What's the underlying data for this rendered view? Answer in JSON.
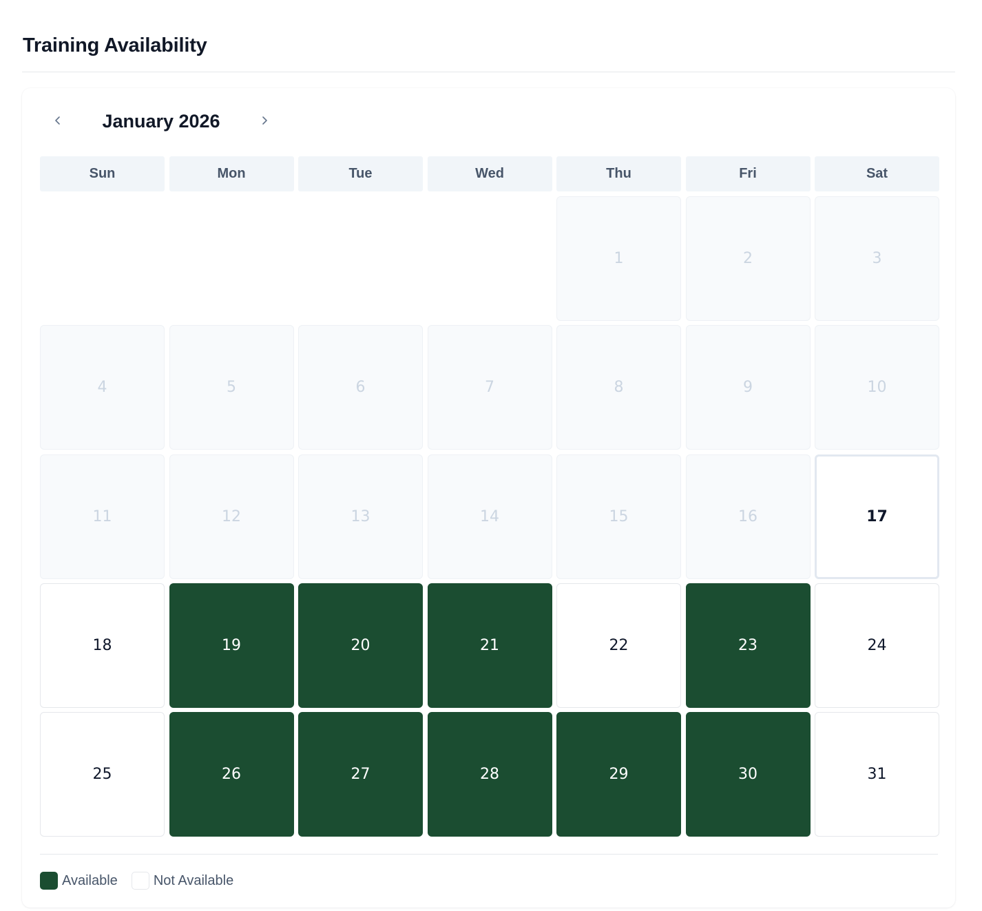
{
  "page": {
    "title": "Training Availability"
  },
  "calendar": {
    "month_label": "January 2026",
    "prev_icon": "chevron-left-icon",
    "next_icon": "chevron-right-icon",
    "weekdays": [
      "Sun",
      "Mon",
      "Tue",
      "Wed",
      "Thu",
      "Fri",
      "Sat"
    ],
    "leading_blanks": 4,
    "today": 17,
    "days": [
      {
        "day": "1",
        "state": "past"
      },
      {
        "day": "2",
        "state": "past"
      },
      {
        "day": "3",
        "state": "past"
      },
      {
        "day": "4",
        "state": "past"
      },
      {
        "day": "5",
        "state": "past"
      },
      {
        "day": "6",
        "state": "past"
      },
      {
        "day": "7",
        "state": "past"
      },
      {
        "day": "8",
        "state": "past"
      },
      {
        "day": "9",
        "state": "past"
      },
      {
        "day": "10",
        "state": "past"
      },
      {
        "day": "11",
        "state": "past"
      },
      {
        "day": "12",
        "state": "past"
      },
      {
        "day": "13",
        "state": "past"
      },
      {
        "day": "14",
        "state": "past"
      },
      {
        "day": "15",
        "state": "past"
      },
      {
        "day": "16",
        "state": "past"
      },
      {
        "day": "17",
        "state": "today"
      },
      {
        "day": "18",
        "state": "unavailable"
      },
      {
        "day": "19",
        "state": "available"
      },
      {
        "day": "20",
        "state": "available"
      },
      {
        "day": "21",
        "state": "available"
      },
      {
        "day": "22",
        "state": "unavailable"
      },
      {
        "day": "23",
        "state": "available"
      },
      {
        "day": "24",
        "state": "unavailable"
      },
      {
        "day": "25",
        "state": "unavailable"
      },
      {
        "day": "26",
        "state": "available"
      },
      {
        "day": "27",
        "state": "available"
      },
      {
        "day": "28",
        "state": "available"
      },
      {
        "day": "29",
        "state": "available"
      },
      {
        "day": "30",
        "state": "available"
      },
      {
        "day": "31",
        "state": "unavailable"
      }
    ]
  },
  "legend": {
    "available_label": "Available",
    "unavailable_label": "Not Available"
  },
  "colors": {
    "available": "#1b4d31",
    "past_background": "#f8fafc",
    "weekday_background": "#f1f5f9"
  }
}
